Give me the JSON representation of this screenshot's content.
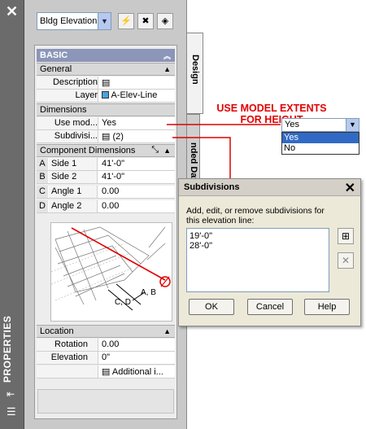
{
  "palette": {
    "title": "PROPERTIES",
    "tabs": {
      "design": "Design",
      "extended": "nded Data"
    },
    "style_select": "Bldg Elevation",
    "basic_header": "BASIC",
    "general": {
      "header": "General",
      "rows": [
        {
          "label": "Description",
          "value": ""
        },
        {
          "label": "Layer",
          "value": "A-Elev-Line"
        }
      ]
    },
    "dimensions": {
      "header": "Dimensions",
      "rows": [
        {
          "label": "Use mod...",
          "value": "Yes"
        },
        {
          "label": "Subdivisi...",
          "value": "(2)"
        }
      ]
    },
    "component_dimensions": {
      "header": "Component Dimensions",
      "rows": [
        {
          "letter": "A",
          "label": "Side 1",
          "value": "41'-0\""
        },
        {
          "letter": "B",
          "label": "Side 2",
          "value": "41'-0\""
        },
        {
          "letter": "C",
          "label": "Angle 1",
          "value": "0.00"
        },
        {
          "letter": "D",
          "label": "Angle 2",
          "value": "0.00"
        }
      ],
      "diagram_labels": {
        "ab": "A, B",
        "cd": "C, D"
      }
    },
    "location": {
      "header": "Location",
      "rows": [
        {
          "label": "Rotation",
          "value": "0.00"
        },
        {
          "label": "Elevation",
          "value": "0\""
        },
        {
          "label": "",
          "value": "Additional i..."
        }
      ]
    }
  },
  "annotation": {
    "line1": "USE MODEL EXTENTS",
    "line2": "FOR HEIGHT"
  },
  "dropdown": {
    "selected": "Yes",
    "options": [
      "Yes",
      "No"
    ]
  },
  "dialog": {
    "title": "Subdivisions",
    "instructions": "Add, edit, or remove subdivisions for this elevation line:",
    "items": [
      "19'-0\"",
      "28'-0\""
    ],
    "buttons": {
      "ok": "OK",
      "cancel": "Cancel",
      "help": "Help"
    }
  },
  "colors": {
    "annotation_red": "#e10000",
    "band": "#8b96b8",
    "selection_blue": "#316ac5"
  }
}
